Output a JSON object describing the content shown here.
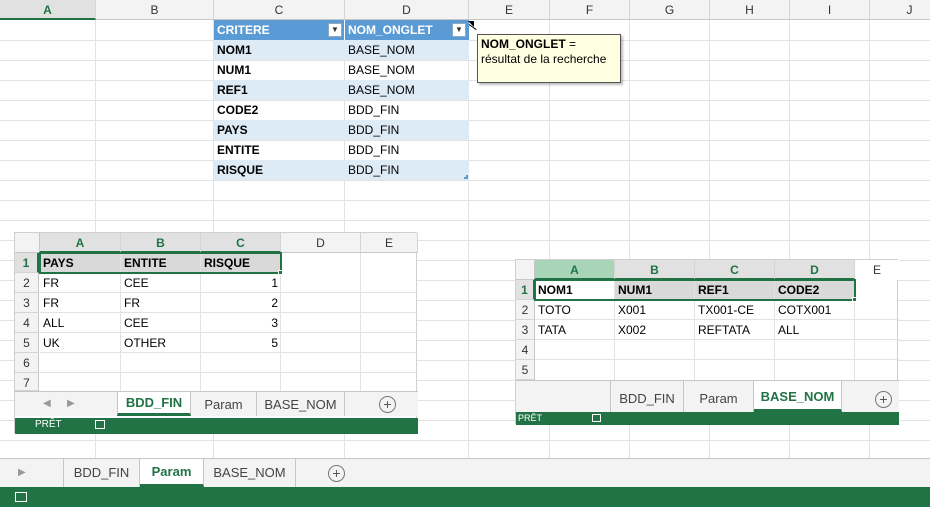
{
  "main": {
    "columns": [
      "A",
      "B",
      "C",
      "D",
      "E",
      "F",
      "G",
      "H",
      "I",
      "J"
    ],
    "table": {
      "headers": [
        "CRITERE",
        "NOM_ONGLET"
      ],
      "rows": [
        [
          "NOM1",
          "BASE_NOM"
        ],
        [
          "NUM1",
          "BASE_NOM"
        ],
        [
          "REF1",
          "BASE_NOM"
        ],
        [
          "CODE2",
          "BDD_FIN"
        ],
        [
          "PAYS",
          "BDD_FIN"
        ],
        [
          "ENTITE",
          "BDD_FIN"
        ],
        [
          "RISQUE",
          "BDD_FIN"
        ]
      ]
    },
    "comment": {
      "title": "NOM_ONGLET",
      "eq": " =",
      "text": "résultat de la recherche"
    }
  },
  "window_bdd": {
    "columns": [
      "A",
      "B",
      "C",
      "D",
      "E"
    ],
    "rows": [
      "1",
      "2",
      "3",
      "4",
      "5",
      "6",
      "7"
    ],
    "data": [
      [
        "PAYS",
        "ENTITE",
        "RISQUE"
      ],
      [
        "FR",
        "CEE",
        "1"
      ],
      [
        "FR",
        "FR",
        "2"
      ],
      [
        "ALL",
        "CEE",
        "3"
      ],
      [
        "UK",
        "OTHER",
        "5"
      ]
    ],
    "tabs": [
      "BDD_FIN",
      "Param",
      "BASE_NOM"
    ],
    "status": "PRÊT"
  },
  "window_base": {
    "columns": [
      "A",
      "B",
      "C",
      "D",
      "E"
    ],
    "rows": [
      "1",
      "2",
      "3",
      "4",
      "5"
    ],
    "data": [
      [
        "NOM1",
        "NUM1",
        "REF1",
        "CODE2"
      ],
      [
        "TOTO",
        "X001",
        "TX001-CE",
        "COTX001"
      ],
      [
        "TATA",
        "X002",
        "REFTATA",
        "ALL"
      ]
    ],
    "tabs": [
      "BDD_FIN",
      "Param",
      "BASE_NOM"
    ],
    "status": "PRÊT"
  },
  "bottom": {
    "tabs": [
      "BDD_FIN",
      "Param",
      "BASE_NOM"
    ],
    "add": "+"
  },
  "colors": {
    "accent": "#217346",
    "table_header": "#5b9bd5",
    "table_band": "#ddebf7",
    "comment_bg": "#ffffe1"
  }
}
